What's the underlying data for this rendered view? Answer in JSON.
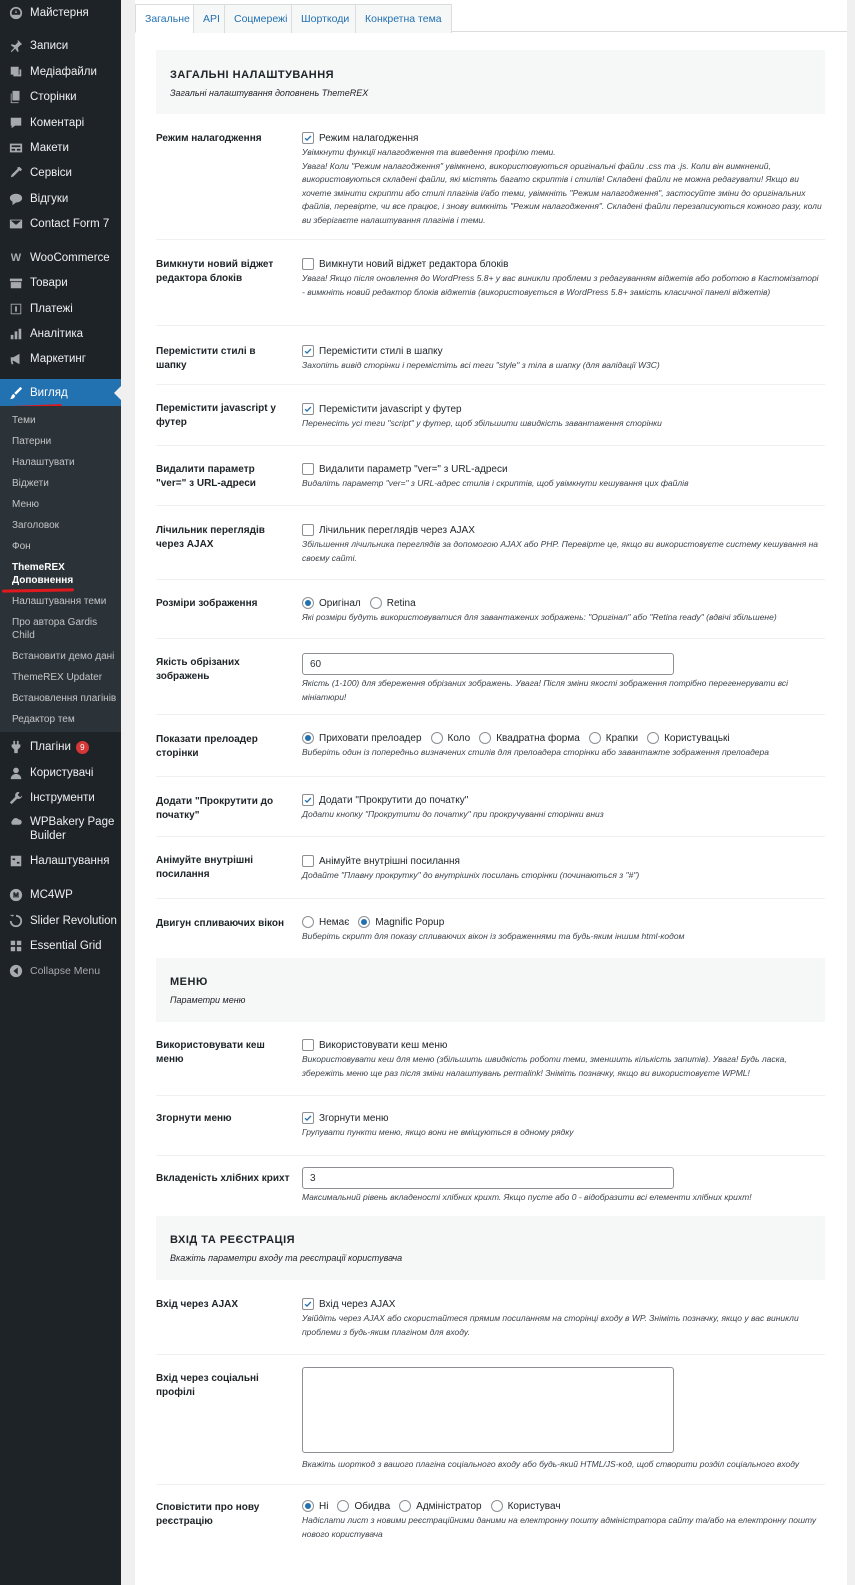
{
  "sidebar": {
    "items": [
      {
        "label": "Майстерня",
        "icon": "dashboard-icon"
      },
      {
        "label": "Записи",
        "icon": "pin-icon"
      },
      {
        "label": "Медіафайли",
        "icon": "media-icon"
      },
      {
        "label": "Сторінки",
        "icon": "pages-icon"
      },
      {
        "label": "Коментарі",
        "icon": "comment-icon"
      },
      {
        "label": "Макети",
        "icon": "layouts-icon"
      },
      {
        "label": "Сервіси",
        "icon": "services-icon"
      },
      {
        "label": "Відгуки",
        "icon": "testimonial-icon"
      },
      {
        "label": "Contact Form 7",
        "icon": "mail-icon"
      },
      {
        "label": "WooCommerce",
        "icon": "woo-icon"
      },
      {
        "label": "Товари",
        "icon": "products-icon"
      },
      {
        "label": "Платежі",
        "icon": "payments-icon"
      },
      {
        "label": "Аналітика",
        "icon": "analytics-icon"
      },
      {
        "label": "Маркетинг",
        "icon": "marketing-icon"
      },
      {
        "label": "Вигляд",
        "icon": "appearance-icon"
      },
      {
        "label": "Плагіни",
        "icon": "plugins-icon",
        "badge": "9"
      },
      {
        "label": "Користувачі",
        "icon": "users-icon"
      },
      {
        "label": "Інструменти",
        "icon": "tools-icon"
      },
      {
        "label": "WPBakery Page Builder",
        "icon": "wpbakery-icon"
      },
      {
        "label": "Налаштування",
        "icon": "settings-icon"
      },
      {
        "label": "MC4WP",
        "icon": "mc4wp-icon"
      },
      {
        "label": "Slider Revolution",
        "icon": "slider-icon"
      },
      {
        "label": "Essential Grid",
        "icon": "grid-icon"
      },
      {
        "label": "Collapse Menu",
        "icon": "collapse-icon"
      }
    ],
    "submenu": [
      "Теми",
      "Патерни",
      "Налаштувати",
      "Віджети",
      "Меню",
      "Заголовок",
      "Фон",
      "ThemeREX Доповнення",
      "Налаштування теми",
      "Про автора Gardis Child",
      "Встановити демо дані",
      "ThemeREX Updater",
      "Встановлення плагінів",
      "Редактор тем"
    ]
  },
  "tabs": [
    "Загальне",
    "API",
    "Соцмережі",
    "Шорткоди",
    "Конкретна тема"
  ],
  "sections": {
    "general": {
      "title": "ЗАГАЛЬНІ НАЛАШТУВАННЯ",
      "desc": "Загальні налаштування доповнень ThemeREX"
    },
    "menu": {
      "title": "МЕНЮ",
      "desc": "Параметри меню"
    },
    "login": {
      "title": "ВХІД ТА РЕЄСТРАЦІЯ",
      "desc": "Вкажіть параметри входу та реєстрації користувача"
    }
  },
  "settings": {
    "debug": {
      "label": "Режим налагодження",
      "option": "Режим налагодження",
      "checked": true,
      "desc": "Увімкнути функції налагодження та виведення профілю теми.\nУвага! Коли \"Режим налагодження\" увімкнено, використовуються оригінальні файли .css та .js. Коли він вимкнений, використовуються складені файли, які містять багато скриптів і стилів! Складені файли не можна редагувати! Якщо ви хочете змінити скрипти або стилі плагінів і/або теми, увімкніть \"Режим налагодження\", застосуйте зміни до оригінальних файлів, перевірте, чи все працює, і знову вимкніть \"Режим налагодження\". Складені файли перезаписуються кожного разу, коли ви зберігаєте налаштування плагінів і теми."
    },
    "widgets": {
      "label": "Вимкнути новий віджет редактора блоків",
      "option": "Вимкнути новий віджет редактора блоків",
      "checked": false,
      "desc": "Увага! Якщо після оновлення до WordPress 5.8+ у вас виникли проблеми з редагуванням віджетів або роботою в Кастомізаторі - вимкніть новий редактор блоків віджетів (використовується в WordPress 5.8+ замість класичної панелі віджетів)"
    },
    "styles": {
      "label": "Перемістити стилі в шапку",
      "option": "Перемістити стилі в шапку",
      "checked": true,
      "desc": "Захопіть вивід сторінки і перемістіть всі теги \"style\" з тіла в шапку (для валідації W3C)"
    },
    "js": {
      "label": "Перемістити javascript у футер",
      "option": "Перемістити javascript у футер",
      "checked": true,
      "desc": "Перенесіть усі теги \"script\" у футер, щоб збільшити швидкість завантаження сторінки"
    },
    "ver": {
      "label": "Видалити параметр \"ver=\" з URL-адреси",
      "option": "Видалити параметр \"ver=\" з URL-адреси",
      "checked": false,
      "desc": "Видаліть параметр \"ver=\" з URL-адрес стилів і скриптів, щоб увімкнути кешування цих файлів"
    },
    "ajax_views": {
      "label": "Лічильник переглядів через AJAX",
      "option": "Лічильник переглядів через AJAX",
      "checked": false,
      "desc": "Збільшення лічильника переглядів за допомогою AJAX або PHP. Перевірте це, якщо ви використовуєте систему кешування на своєму сайті."
    },
    "image_sizes": {
      "label": "Розміри зображення",
      "options": [
        "Оригінал",
        "Retina"
      ],
      "selected": 0,
      "desc": "Які розміри будуть використовуватися для завантажених зображень: \"Оригінал\" або \"Retina ready\" (вдвічі збільшене)"
    },
    "quality": {
      "label": "Якість обрізаних зображень",
      "value": "60",
      "desc": "Якість (1-100) для збереження обрізаних зображень. Увага! Після зміни якості зображення потрібно перегенерувати всі мініатюри!"
    },
    "preloader": {
      "label": "Показати прелоадер сторінки",
      "options": [
        "Приховати прелоадер",
        "Коло",
        "Квадратна форма",
        "Крапки",
        "Користувацькі"
      ],
      "selected": 0,
      "desc": "Виберіть один із попередньо визначених стилів для прелоадера сторінки або завантажте зображення прелоадера"
    },
    "scroll_top": {
      "label": "Додати \"Прокрутити до початку\"",
      "option": "Додати \"Прокрутити до початку\"",
      "checked": true,
      "desc": "Додати кнопку \"Прокрутити до початку\" при прокручуванні сторінки вниз"
    },
    "anchors": {
      "label": "Анімуйте внутрішні посилання",
      "option": "Анімуйте внутрішні посилання",
      "checked": false,
      "desc": "Додайте \"Плавну прокрутку\" до внутрішніх посилань сторінки (починаються з \"#\")"
    },
    "popup": {
      "label": "Двигун спливаючих вікон",
      "options": [
        "Немає",
        "Magnific Popup"
      ],
      "selected": 1,
      "desc": "Виберіть скрипт для показу спливаючих вікон із зображеннями та будь-яким іншим html-кодом"
    },
    "menu_cache": {
      "label": "Використовувати кеш меню",
      "option": "Використовувати кеш меню",
      "checked": false,
      "desc": "Використовувати кеш для меню (збільшить швидкість роботи теми, зменшить кількість запитів). Увага! Будь ласка, збережіть меню ще раз після зміни налаштувань permalink! Зніміть позначку, якщо ви використовуєте WPML!"
    },
    "menu_collapse": {
      "label": "Згорнути меню",
      "option": "Згорнути меню",
      "checked": true,
      "desc": "Групувати пункти меню, якщо вони не вміщуються в одному рядку"
    },
    "breadcrumbs": {
      "label": "Вкладеність хлібних крихт",
      "value": "3",
      "desc": "Максимальний рівень вкладеності хлібних крихт. Якщо пусте або 0 - відобразити всі елементи хлібних крихт!"
    },
    "login_ajax": {
      "label": "Вхід через AJAX",
      "option": "Вхід через AJAX",
      "checked": true,
      "desc": "Увійдіть через AJAX або скористайтеся прямим посиланням на сторінці входу в WP. Зніміть позначку, якщо у вас виникли проблеми з будь-яким плагіном для входу."
    },
    "social_login": {
      "label": "Вхід через соціальні профілі",
      "value": "",
      "desc": "Вкажіть шорткод з вашого плагіна соціального входу або будь-який HTML/JS-код, щоб створити розділ соціального входу"
    },
    "notify": {
      "label": "Сповістити про нову реєстрацію",
      "options": [
        "Ні",
        "Обидва",
        "Адміністратор",
        "Користувач"
      ],
      "selected": 0,
      "desc": "Надіслати лист з новими реєстраційними даними на електронну пошту адміністратора сайту та/або на електронну пошту нового користувача"
    }
  },
  "colors": {
    "accent": "#2271b1",
    "sidebar": "#1d2327",
    "submenu": "#2c3338",
    "highlight": "#e0191e",
    "badge": "#d63638"
  }
}
